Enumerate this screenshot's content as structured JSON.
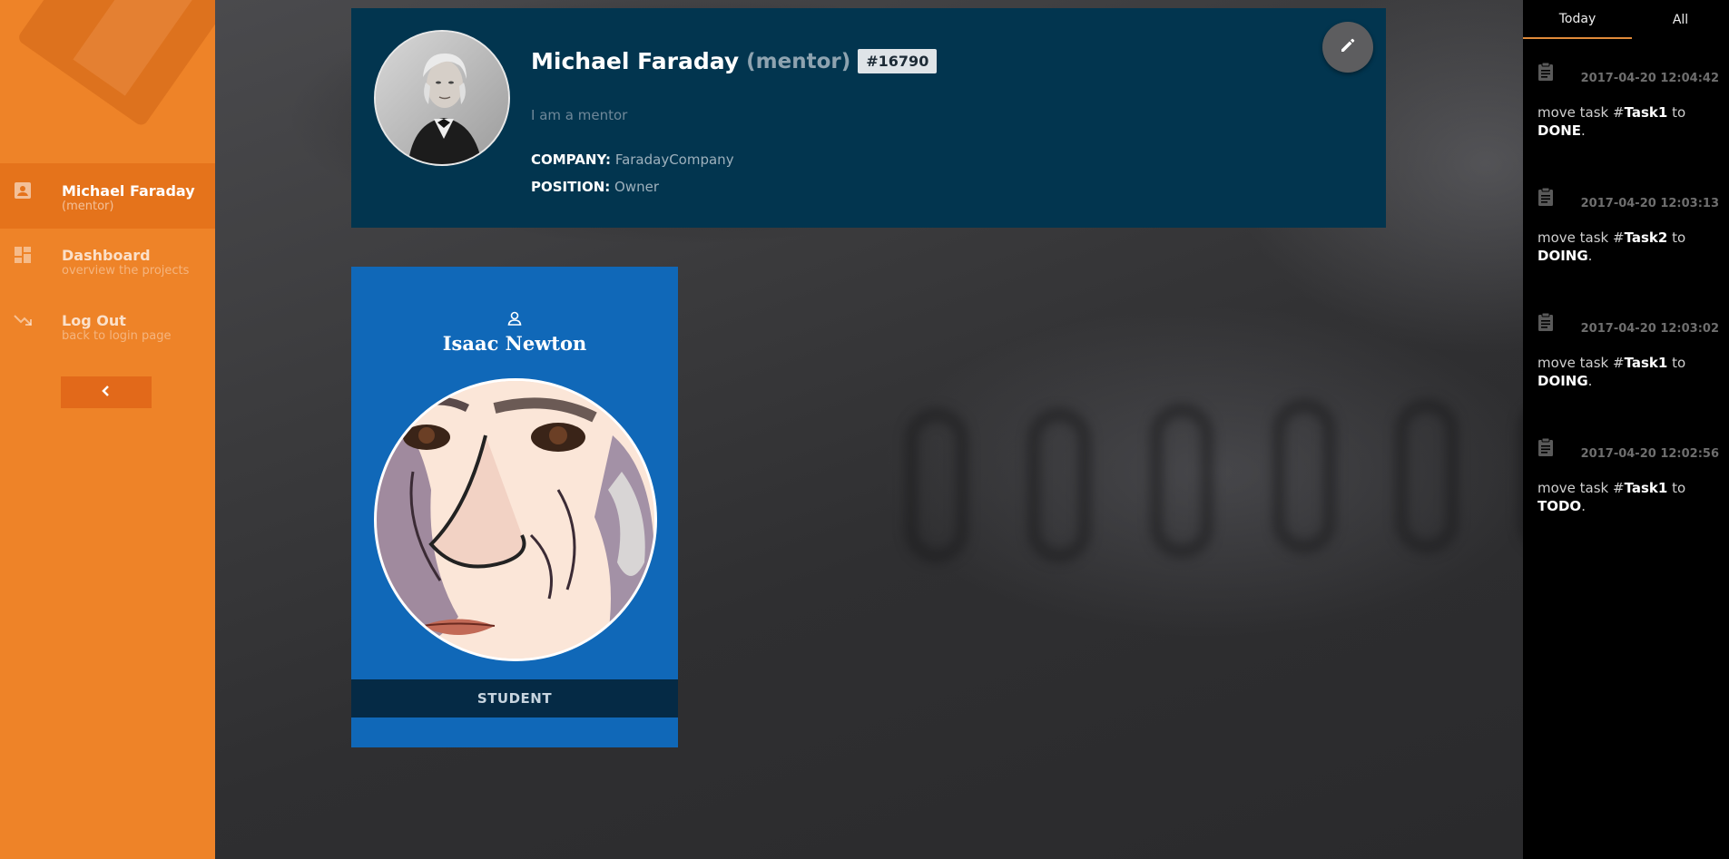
{
  "sidebar": {
    "items": [
      {
        "title": "Michael Faraday",
        "subtitle": "(mentor)",
        "icon": "contact-card-icon"
      },
      {
        "title": "Dashboard",
        "subtitle": "overview the projects",
        "icon": "dashboard-icon"
      },
      {
        "title": "Log Out",
        "subtitle": "back to login page",
        "icon": "trending-down-icon"
      }
    ],
    "collapse_icon": "chevron-left-icon"
  },
  "profile": {
    "name": "Michael Faraday",
    "role": "(mentor)",
    "id": "#16790",
    "bio": "I am a mentor",
    "company_label": "COMPANY:",
    "company": "FaradayCompany",
    "position_label": "POSITION:",
    "position": "Owner",
    "edit_icon": "pencil-icon"
  },
  "student": {
    "name": "Isaac Newton",
    "role": "STUDENT",
    "icon": "person-icon"
  },
  "activity": {
    "tabs": [
      "Today",
      "All"
    ],
    "entries": [
      {
        "time": "2017-04-20 12:04:42",
        "prefix": "move task #",
        "task": "Task1",
        "mid": " to",
        "state": "DONE",
        "end": "."
      },
      {
        "time": "2017-04-20 12:03:13",
        "prefix": "move task #",
        "task": "Task2",
        "mid": " to",
        "state": "DOING",
        "end": "."
      },
      {
        "time": "2017-04-20 12:03:02",
        "prefix": "move task #",
        "task": "Task1",
        "mid": " to",
        "state": "DOING",
        "end": "."
      },
      {
        "time": "2017-04-20 12:02:56",
        "prefix": "move task #",
        "task": "Task1",
        "mid": " to",
        "state": "TODO",
        "end": "."
      }
    ]
  },
  "colors": {
    "sidebar": "#ee8328",
    "profile_bg": "#02354f",
    "student_bg": "#1068b8",
    "accent_tab": "#e08a3a"
  }
}
